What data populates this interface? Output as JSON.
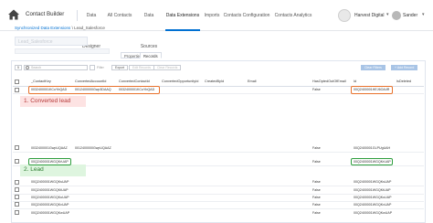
{
  "nav": {
    "app_title": "Contact Builder",
    "tabs": [
      "Data Designer",
      "All Contacts",
      "Data Sources",
      "Data Extensions",
      "Imports",
      "Contacts Configuration",
      "Contacts Analytics"
    ],
    "org": "Harvest Digital",
    "user": "Sander"
  },
  "header": {
    "breadcrumb_link": "Synchronized Data Extensions",
    "breadcrumb_current": "Lead_Salesforce",
    "title": "Lead_Salesforce",
    "view_tabs": [
      "Properties",
      "Records"
    ]
  },
  "toolbar": {
    "page_size": "5",
    "search_placeholder": "Search",
    "filter_label": "Filter",
    "export_label": "Export",
    "edit_records_label": "Edit Records",
    "clear_records_label": "Clear Records",
    "clear_filters_label": "Clear Filters",
    "add_record_label": "+ Add Record"
  },
  "table": {
    "columns": [
      "_ContactKey",
      "ConvertedAccountId",
      "ConvertedContactId",
      "ConvertedOpportunityId",
      "CreatedById",
      "Email",
      "HasOptedOutOfEmail",
      "Id",
      "IsDeleted"
    ],
    "rows": [
      {
        "contact_key": "0032400001KCuYbQAD",
        "account_id": "0012400000Gwp3DAAQ",
        "contact_id": "0032400001KCuYbQAD",
        "opted_out": "False",
        "id": "00Q2400001HEJ6OA4R"
      },
      {
        "contact_key": "0032400001GwpUQAAZ",
        "account_id": "0012400000GwpUQAAZ",
        "contact_id": "",
        "opted_out": "False",
        "id": "00Q2400001GLPUgUAH"
      },
      {
        "contact_key": "00Q2400001WGQKrUAP",
        "account_id": "",
        "contact_id": "",
        "opted_out": "False",
        "id": "00Q2400001WGQKrUAP"
      },
      {
        "contact_key": "00Q2400001WGQKsUAP",
        "account_id": "",
        "contact_id": "",
        "opted_out": "False",
        "id": "00Q2400001WGQKsUAP"
      },
      {
        "contact_key": "00Q2400001WGQKtUAP",
        "account_id": "",
        "contact_id": "",
        "opted_out": "False",
        "id": "00Q2400001WGQKtUAP"
      },
      {
        "contact_key": "00Q2400001WGQKuUAP",
        "account_id": "",
        "contact_id": "",
        "opted_out": "False",
        "id": "00Q2400001WGQKuUAP"
      },
      {
        "contact_key": "00Q2400001WGQKvUAP",
        "account_id": "",
        "contact_id": "",
        "opted_out": "False",
        "id": "00Q2400001WGQKvUAP"
      },
      {
        "contact_key": "00Q2400001WGQKwUAP",
        "account_id": "",
        "contact_id": "",
        "opted_out": "False",
        "id": "00Q2400001WGQKwUAP"
      }
    ]
  },
  "annotations": {
    "converted_lead": "1. Converted lead",
    "lead": "2.  Lead"
  },
  "colors": {
    "active_tab": "#0070d2",
    "highlight_orange": "#e8722c",
    "highlight_green": "#2e9e3e"
  }
}
